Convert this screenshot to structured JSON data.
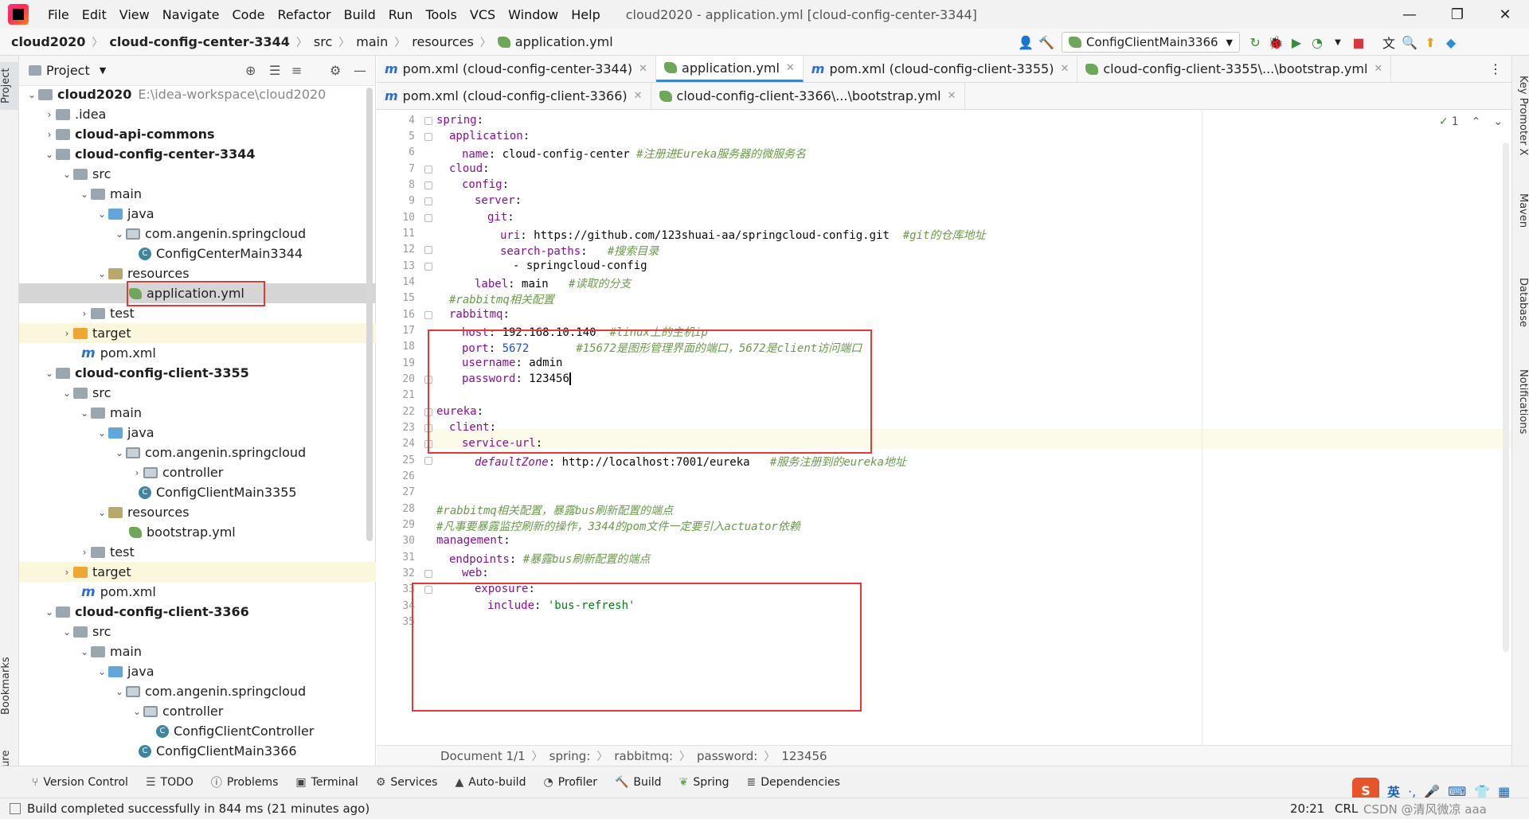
{
  "menubar": {
    "items": [
      "File",
      "Edit",
      "View",
      "Navigate",
      "Code",
      "Refactor",
      "Build",
      "Run",
      "Tools",
      "VCS",
      "Window",
      "Help"
    ],
    "window_title": "cloud2020 - application.yml [cloud-config-center-3344]"
  },
  "navbar": {
    "breadcrumbs": [
      "cloud2020",
      "cloud-config-center-3344",
      "src",
      "main",
      "resources",
      "application.yml"
    ],
    "run_config": "ConfigClientMain3366"
  },
  "left_strip": {
    "project": "Project",
    "bookmarks": "Bookmarks",
    "structure": "Structure"
  },
  "right_strip": {
    "key_promoter": "Key Promoter X",
    "maven": "Maven",
    "database": "Database",
    "notifications": "Notifications"
  },
  "project_panel": {
    "title": "Project",
    "tree": [
      {
        "label": "cloud2020",
        "extra": "E:\\idea-workspace\\cloud2020"
      },
      {
        "label": ".idea"
      },
      {
        "label": "cloud-api-commons"
      },
      {
        "label": "cloud-config-center-3344"
      },
      {
        "label": "src"
      },
      {
        "label": "main"
      },
      {
        "label": "java"
      },
      {
        "label": "com.angenin.springcloud"
      },
      {
        "label": "ConfigCenterMain3344"
      },
      {
        "label": "resources"
      },
      {
        "label": "application.yml"
      },
      {
        "label": "test"
      },
      {
        "label": "target"
      },
      {
        "label": "pom.xml"
      },
      {
        "label": "cloud-config-client-3355"
      },
      {
        "label": "src"
      },
      {
        "label": "main"
      },
      {
        "label": "java"
      },
      {
        "label": "com.angenin.springcloud"
      },
      {
        "label": "controller"
      },
      {
        "label": "ConfigClientMain3355"
      },
      {
        "label": "resources"
      },
      {
        "label": "bootstrap.yml"
      },
      {
        "label": "test"
      },
      {
        "label": "target"
      },
      {
        "label": "pom.xml"
      },
      {
        "label": "cloud-config-client-3366"
      },
      {
        "label": "src"
      },
      {
        "label": "main"
      },
      {
        "label": "java"
      },
      {
        "label": "com.angenin.springcloud"
      },
      {
        "label": "controller"
      },
      {
        "label": "ConfigClientController"
      },
      {
        "label": "ConfigClientMain3366"
      }
    ]
  },
  "tabs_row1": [
    "pom.xml (cloud-config-center-3344)",
    "application.yml",
    "pom.xml (cloud-config-client-3355)",
    "cloud-config-client-3355\\...\\bootstrap.yml"
  ],
  "tabs_row2": [
    "pom.xml (cloud-config-client-3366)",
    "cloud-config-client-3366\\...\\bootstrap.yml"
  ],
  "editor": {
    "inspection_count": "1",
    "lines": {
      "n4": "4",
      "n5": "5",
      "n6": "6",
      "n7": "7",
      "n8": "8",
      "n9": "9",
      "n10": "10",
      "n11": "11",
      "n12": "12",
      "n13": "13",
      "n14": "14",
      "n15": "15",
      "n16": "16",
      "n17": "17",
      "n18": "18",
      "n19": "19",
      "n20": "20",
      "n21": "21",
      "n22": "22",
      "n23": "23",
      "n24": "24",
      "n25": "25",
      "n26": "26",
      "n27": "27",
      "n28": "28",
      "n29": "29",
      "n30": "30",
      "n31": "31",
      "n32": "32",
      "n33": "33",
      "n34": "34",
      "n35": "35"
    },
    "code": {
      "l4k": "spring",
      "l5k": "application",
      "l6k": "name",
      "l6v": "cloud-config-center",
      "l6c": "#注册进Eureka服务器的微服务名",
      "l7k": "cloud",
      "l8k": "config",
      "l9k": "server",
      "l10k": "git",
      "l11k": "uri",
      "l11v": "https://github.com/123shuai-aa/springcloud-config.git",
      "l11c": "#git的仓库地址",
      "l12k": "search-paths",
      "l12c": "#搜索目录",
      "l13v": "- springcloud-config",
      "l14k": "label",
      "l14v": "main",
      "l14c": "#读取的分支",
      "l15c": "#rabbitmq相关配置",
      "l16k": "rabbitmq",
      "l17k": "host",
      "l17v": "192.168.10.140",
      "l17c": "#linux上的主机ip",
      "l18k": "port",
      "l18v": "5672",
      "l18c": "#15672是图形管理界面的端口，5672是client访问端口",
      "l19k": "username",
      "l19v": "admin",
      "l20k": "password",
      "l20v": "123456",
      "l22k": "eureka",
      "l23k": "client",
      "l24k": "service-url",
      "l25k": "defaultZone",
      "l25v": "http://localhost:7001/eureka",
      "l25c": "#服务注册到的eureka地址",
      "l28c": "#rabbitmq相关配置，暴露bus刷新配置的端点",
      "l29c": "#凡事要暴露监控刷新的操作，3344的pom文件一定要引入actuator依赖",
      "l30k": "management",
      "l31k": "endpoints",
      "l31c": "#暴露bus刷新配置的端点",
      "l32k": "web",
      "l33k": "exposure",
      "l34k": "include",
      "l34v": "'bus-refresh'"
    }
  },
  "breadcrumb_bar": [
    "Document 1/1",
    "spring:",
    "rabbitmq:",
    "password:",
    "123456"
  ],
  "tool_windows": [
    "Version Control",
    "TODO",
    "Problems",
    "Terminal",
    "Services",
    "Auto-build",
    "Profiler",
    "Build",
    "Spring",
    "Dependencies"
  ],
  "status": {
    "message": "Build completed successfully in 844 ms (21 minutes ago)",
    "position": "20:21",
    "encoding": "CRL",
    "watermark": "CSDN @清风微凉 aaa"
  },
  "ime": {
    "lang": "英"
  }
}
